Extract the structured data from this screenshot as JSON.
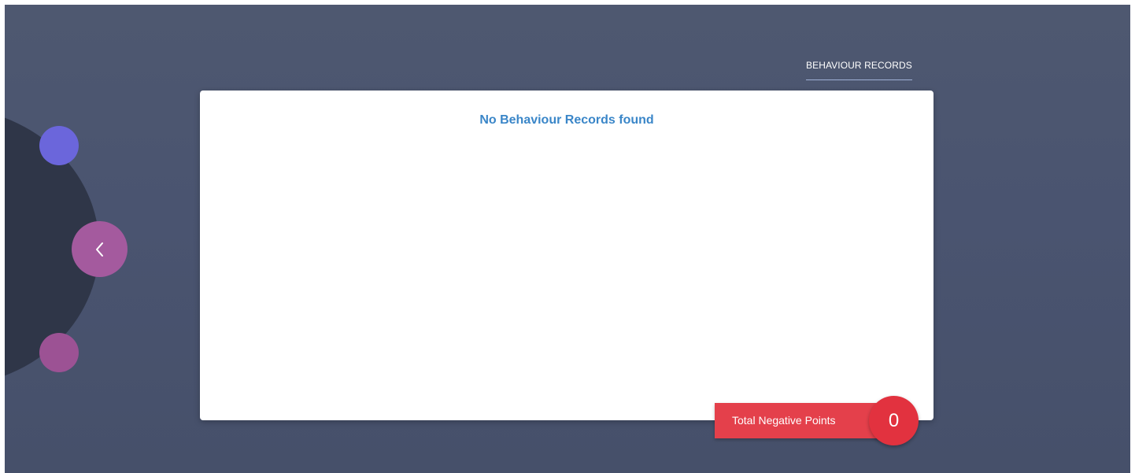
{
  "nav": {
    "back_icon": "chevron-left-icon",
    "tab_label": "BEHAVIOUR RECORDS"
  },
  "records": {
    "empty_message": "No Behaviour Records found"
  },
  "summary": {
    "label": "Total Negative Points",
    "count": "0"
  },
  "colors": {
    "background": "#4a5470",
    "arc": "#2f3648",
    "node_top": "#6b66db",
    "node_back": "#a45a9e",
    "node_bottom": "#9c5294",
    "message_text": "#3a86c8",
    "summary_bar": "#e4404b",
    "summary_badge": "#e2323f"
  }
}
